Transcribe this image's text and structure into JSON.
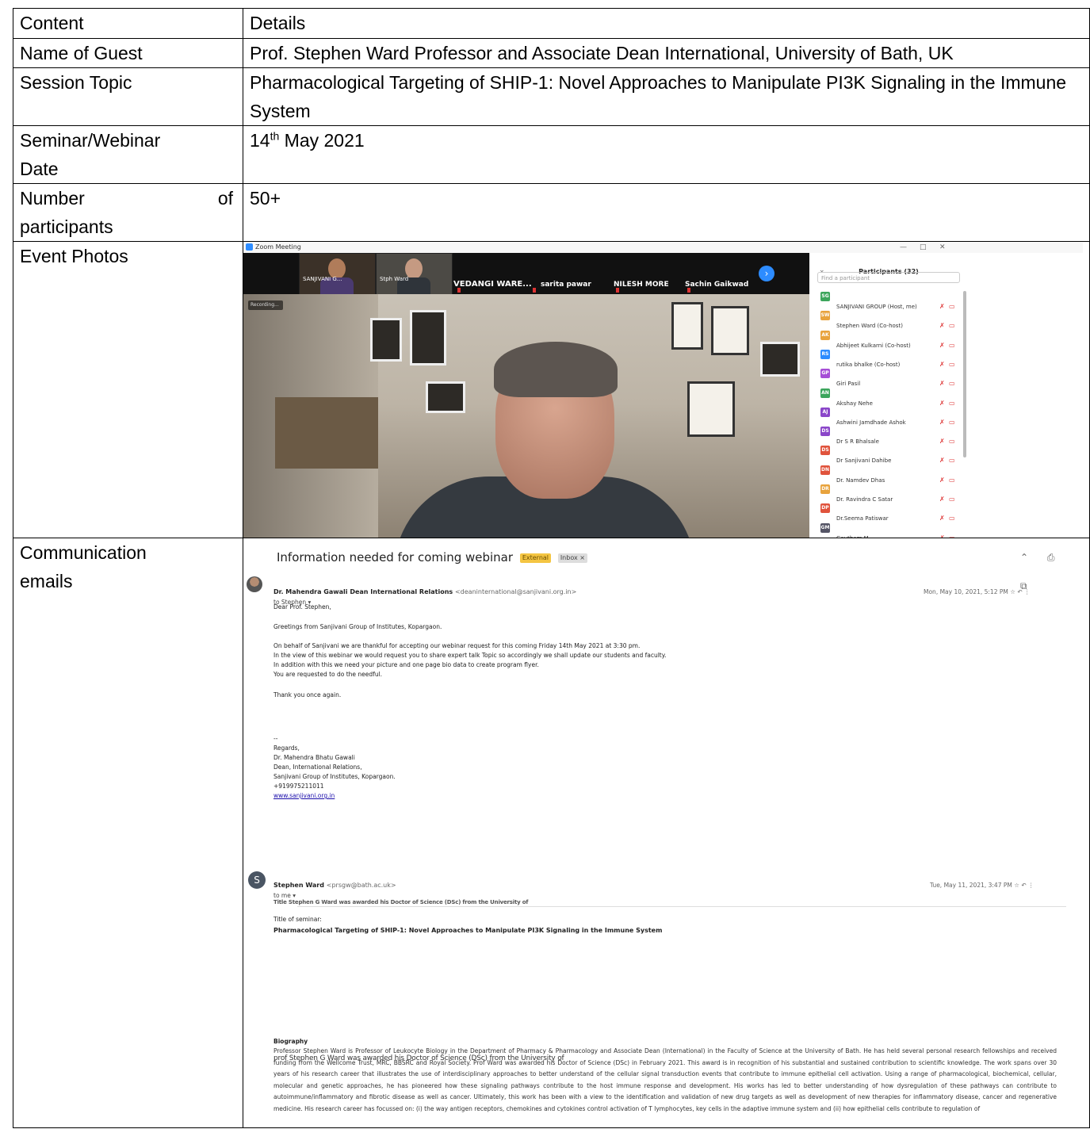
{
  "table": {
    "header": {
      "col1": "Content",
      "col2": "Details"
    },
    "guest": {
      "label": "Name of Guest",
      "value": "Prof. Stephen Ward Professor and Associate Dean International, University of Bath, UK"
    },
    "topic": {
      "label": "Session Topic",
      "value": "Pharmacological Targeting of SHIP-1: Novel Approaches to Manipulate PI3K Signaling in the Immune System"
    },
    "date": {
      "label_line1": "Seminar/Webinar",
      "label_line2": "Date",
      "day": "14",
      "suffix": "th",
      "rest": " May 2021"
    },
    "participants": {
      "label_word1": "Number",
      "label_word2": "of",
      "label_line2": "participants",
      "value": "50+"
    },
    "photos": {
      "label": "Event Photos"
    },
    "emails": {
      "label_line1": "Communication",
      "label_line2": "emails"
    }
  },
  "zoom": {
    "window_title": "Zoom Meeting",
    "thumbnails": [
      "SANJIVANI G...",
      "Stph Ward"
    ],
    "strip_names": [
      "VEDANGI WARE...",
      "sarita pawar",
      "NILESH MORE",
      "Sachin Gaikwad"
    ],
    "video_tag": "Recording...",
    "panel_title": "Participants (32)",
    "search_placeholder": "Find a participant",
    "participants": [
      {
        "initials": "SG",
        "name": "SANJIVANI GROUP (Host, me)",
        "color": "#3ca55c"
      },
      {
        "initials": "SW",
        "name": "Stephen Ward (Co-host)",
        "color": "#e8a33d"
      },
      {
        "initials": "AK",
        "name": "Abhijeet Kulkarni (Co-host)",
        "color": "#e8a33d"
      },
      {
        "initials": "RS",
        "name": "rutika bhalke (Co-host)",
        "color": "#2d8cff"
      },
      {
        "initials": "GP",
        "name": "Giri Pasil",
        "color": "#a64dd6"
      },
      {
        "initials": "AN",
        "name": "Akshay Nehe",
        "color": "#3ca55c"
      },
      {
        "initials": "AJ",
        "name": "Ashwini Jamdhade Ashok",
        "color": "#8a46c9"
      },
      {
        "initials": "DS",
        "name": "Dr S R Bhalsale",
        "color": "#8a46c9"
      },
      {
        "initials": "DS",
        "name": "Dr Sanjivani Dahibe",
        "color": "#e0533c"
      },
      {
        "initials": "DN",
        "name": "Dr. Namdev Dhas",
        "color": "#e0533c"
      },
      {
        "initials": "DR",
        "name": "Dr. Ravindra C Satar",
        "color": "#e8a33d"
      },
      {
        "initials": "DP",
        "name": "Dr.Seema Patiswar",
        "color": "#e0533c"
      },
      {
        "initials": "GM",
        "name": "Gautham M",
        "color": "#556"
      }
    ]
  },
  "email": {
    "subject": "Information needed for coming webinar",
    "tag_external": "External",
    "tag_inbox": "Inbox ×",
    "top_icons": "⌃ ⎙ ⧉",
    "msg1": {
      "sender": "Dr. Mahendra Gawali Dean International Relations",
      "address": "<deaninternational@sanjivani.org.in>",
      "to": "to Stephen ▾",
      "when": "Mon, May 10, 2021, 5:12 PM  ☆  ↶  ⋮",
      "lines": [
        "Dear Prof. Stephen,",
        "Greetings from Sanjivani Group of Institutes, Kopargaon.",
        "On behalf of Sanjivani we are thankful for accepting our webinar request for this coming Friday 14th May 2021 at 3:30 pm.",
        "In the view of this webinar we would request you to share expert talk Topic so accordingly we shall update our students and faculty.",
        "In addition with this we need your picture and one page bio data to create program flyer.",
        "You are requested to do the needful.",
        "Thank you once again.",
        "--",
        "Regards,",
        "Dr. Mahendra Bhatu Gawali",
        "Dean, International Relations,",
        "Sanjivani Group of Institutes, Kopargaon.",
        "+919975211011",
        "www.sanjivani.org.in"
      ]
    },
    "msg2": {
      "sender": "Stephen Ward",
      "address": "<prsgw@bath.ac.uk>",
      "to": "to me ▾",
      "when": "Tue, May 11, 2021, 3:47 PM  ☆  ↶  ⋮",
      "garbled": "Title Stephen G Ward was awarded his Doctor of Science (DSc) from the University of",
      "title_label": "Title of seminar:",
      "title_value": "Pharmacological Targeting of SHIP-1: Novel Approaches to Manipulate PI3K Signaling in the Immune System",
      "bio_heading": "Biography",
      "bio_overlap": "prof Stephen G Ward was awarded his Doctor of Science (DSc) from the University of",
      "bio": "Professor Stephen Ward is Professor of Leukocyte Biology in the Department of Pharmacy & Pharmacology and Associate Dean (International) in the Faculty of Science at the University of Bath. He has held several personal research fellowships and received funding from the Wellcome Trust, MRC, BBSRC and Royal Society. Prof Ward was awarded his Doctor of Science (DSc) in February 2021. This award is in recognition of his substantial and sustained contribution to scientific knowledge. The work spans over 30 years of his research career that illustrates the use of interdisciplinary approaches to better understand of the cellular signal transduction events that contribute to immune epithelial cell activation. Using a range of pharmacological, biochemical, cellular, molecular and genetic approaches, he has pioneered how these signaling pathways contribute to the host immune response and development. His works has led to better understanding of how dysregulation of these pathways can contribute to autoimmune/inflammatory and fibrotic disease as well as cancer. Ultimately, this work has been with a view to the identification and validation of new drug targets as well as development of new therapies for inflammatory disease, cancer and regenerative medicine. His research career has focussed on: (i) the way antigen receptors, chemokines and cytokines control activation of T lymphocytes, key cells in the adaptive immune system and (ii) how epithelial cells contribute to regulation of"
    }
  }
}
